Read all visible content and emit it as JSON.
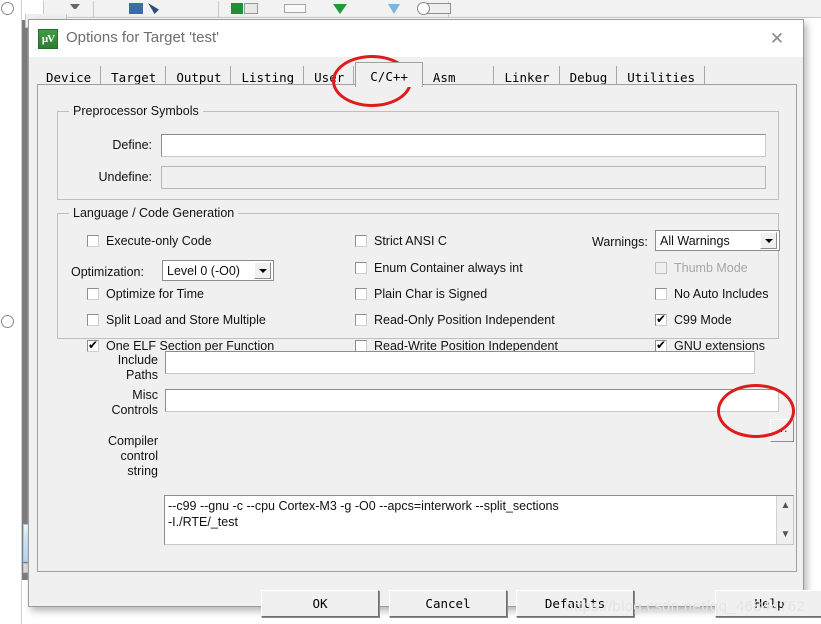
{
  "window": {
    "title": "Options for Target 'test'",
    "icon": "uvision-logo-icon",
    "close_label": "✕"
  },
  "tabs": [
    {
      "label": "Device",
      "active": false
    },
    {
      "label": "Target",
      "active": false
    },
    {
      "label": "Output",
      "active": false
    },
    {
      "label": "Listing",
      "active": false
    },
    {
      "label": "User",
      "active": false
    },
    {
      "label": "C/C++",
      "active": true
    },
    {
      "label": "Asm",
      "active": false
    },
    {
      "label": "Linker",
      "active": false
    },
    {
      "label": "Debug",
      "active": false
    },
    {
      "label": "Utilities",
      "active": false
    }
  ],
  "preprocessor": {
    "group_title": "Preprocessor Symbols",
    "define_label": "Define:",
    "define_value": "",
    "undefine_label": "Undefine:",
    "undefine_value": ""
  },
  "language": {
    "group_title": "Language / Code Generation",
    "col1": [
      {
        "label": "Execute-only Code",
        "checked": false,
        "enabled": true
      },
      {
        "label": "Optimize for Time",
        "checked": false,
        "enabled": true
      },
      {
        "label": "Split Load and Store Multiple",
        "checked": false,
        "enabled": true
      },
      {
        "label": "One ELF Section per Function",
        "checked": true,
        "enabled": true
      }
    ],
    "optimization_label": "Optimization:",
    "optimization_value": "Level 0 (-O0)",
    "col2": [
      {
        "label": "Strict ANSI C",
        "checked": false,
        "enabled": true
      },
      {
        "label": "Enum Container always int",
        "checked": false,
        "enabled": true
      },
      {
        "label": "Plain Char is Signed",
        "checked": false,
        "enabled": true
      },
      {
        "label": "Read-Only Position Independent",
        "checked": false,
        "enabled": true
      },
      {
        "label": "Read-Write Position Independent",
        "checked": false,
        "enabled": true
      }
    ],
    "warnings_label": "Warnings:",
    "warnings_value": "All Warnings",
    "col3": [
      {
        "label": "Thumb Mode",
        "checked": false,
        "enabled": false
      },
      {
        "label": "No Auto Includes",
        "checked": false,
        "enabled": true
      },
      {
        "label": "C99 Mode",
        "checked": true,
        "enabled": true
      },
      {
        "label": "GNU extensions",
        "checked": true,
        "enabled": true
      }
    ]
  },
  "paths": {
    "include_label_line1": "Include",
    "include_label_line2": "Paths",
    "include_value": "",
    "browse_label": "...",
    "misc_label_line1": "Misc",
    "misc_label_line2": "Controls",
    "misc_value": "",
    "compiler_label_line1": "Compiler",
    "compiler_label_line2": "control",
    "compiler_label_line3": "string",
    "compiler_value_line1": "--c99 --gnu -c --cpu Cortex-M3 -g -O0 --apcs=interwork --split_sections",
    "compiler_value_line2": "-I./RTE/_test",
    "scroll_up": "▲",
    "scroll_down": "▼"
  },
  "buttons": {
    "ok": "OK",
    "cancel": "Cancel",
    "defaults": "Defaults",
    "help": "Help"
  },
  "annotations": {
    "circle_tab": "red-ellipse-around-cpp-tab",
    "circle_browse": "red-ellipse-around-browse-button",
    "color": "#e01b1b"
  },
  "watermark": "https://blog.csdn.net/qq_46844762"
}
